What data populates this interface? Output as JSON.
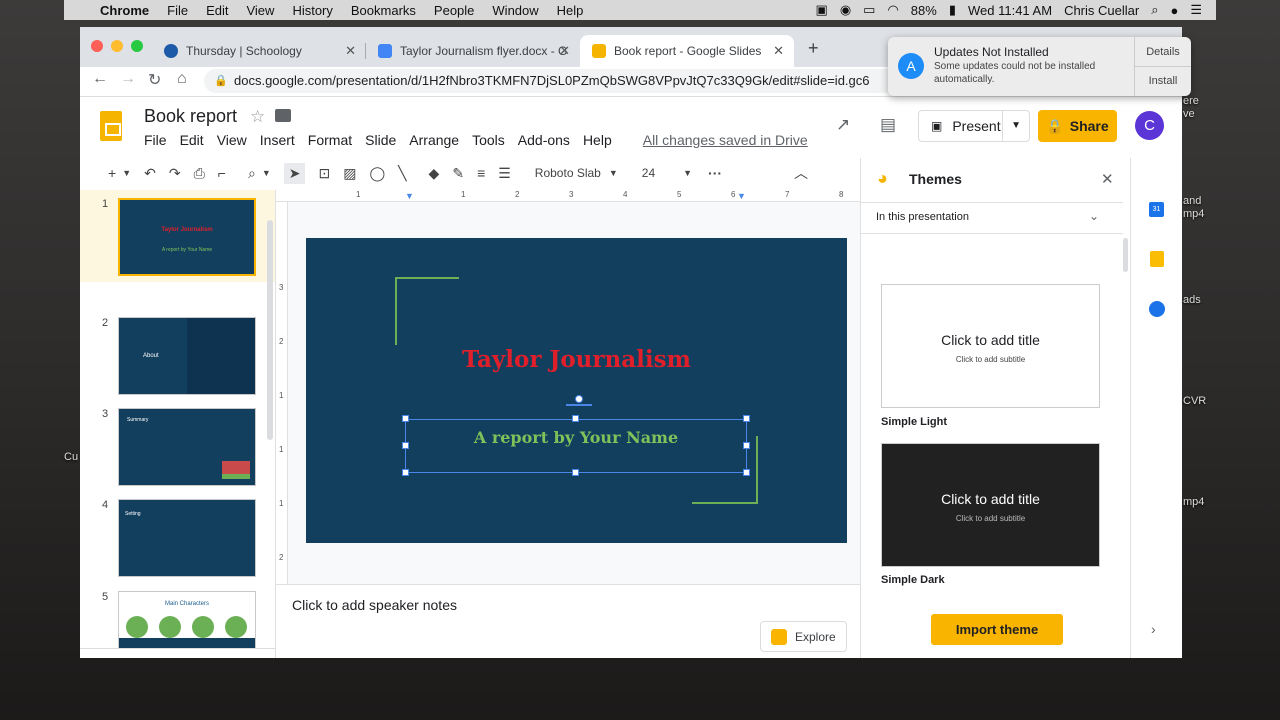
{
  "macbar": {
    "apple": "",
    "menus": [
      "Chrome",
      "File",
      "Edit",
      "View",
      "History",
      "Bookmarks",
      "People",
      "Window",
      "Help"
    ],
    "battery": "88%",
    "clock": "Wed 11:41 AM",
    "user": "Chris Cuellar"
  },
  "desktop": {
    "labels": [
      "Cu",
      "and",
      "mp4",
      "ads",
      "CVR",
      "mp4",
      "ere",
      "ve"
    ]
  },
  "browser": {
    "tabs": [
      {
        "label": "Thursday | Schoology",
        "color": "#1d5aa8"
      },
      {
        "label": "Taylor Journalism flyer.docx - G",
        "color": "#4285f4"
      },
      {
        "label": "Book report - Google Slides",
        "color": "#f4b400"
      }
    ],
    "new_tab": "+",
    "url": "docs.google.com/presentation/d/1H2fNbro3TKMFN7DjSL0PZmQbSWG8VPpvJtQ7c33Q9Gk/edit#slide=id.gc6"
  },
  "notification": {
    "title": "Updates Not Installed",
    "body": "Some updates could not be installed automatically.",
    "details": "Details",
    "install": "Install"
  },
  "docs": {
    "title": "Book report",
    "menu": [
      "File",
      "Edit",
      "View",
      "Insert",
      "Format",
      "Slide",
      "Arrange",
      "Tools",
      "Add-ons",
      "Help"
    ],
    "saved": "All changes saved in Drive",
    "present": "Present",
    "share": "Share",
    "avatar": "C"
  },
  "toolbar": {
    "font": "Roboto Slab",
    "size": "24",
    "more": "···"
  },
  "ruler": {
    "h": [
      "1",
      "1",
      "2",
      "3",
      "4",
      "5",
      "6",
      "7",
      "8"
    ],
    "v": [
      "3",
      "2",
      "1",
      "1",
      "1",
      "2"
    ]
  },
  "filmstrip": [
    {
      "num": "1",
      "t": "Taylor Journalism",
      "s": "A report by Your Name"
    },
    {
      "num": "2",
      "t": "About"
    },
    {
      "num": "3",
      "t": "Summary"
    },
    {
      "num": "4",
      "t": "Setting"
    },
    {
      "num": "5",
      "t": "Main Characters"
    }
  ],
  "slide": {
    "title": "Taylor Journalism",
    "subtitle": "A report by Your Name"
  },
  "notes": "Click to add speaker notes",
  "explore": "Explore",
  "themes": {
    "title": "Themes",
    "dropdown": "In this presentation",
    "cards": [
      {
        "name": "Simple Light",
        "ct": "Click to add title",
        "cs": "Click to add subtitle",
        "bg": "#ffffff",
        "fg": "#202124"
      },
      {
        "name": "Simple Dark",
        "ct": "Click to add title",
        "cs": "Click to add subtitle",
        "bg": "#212121",
        "fg": "#ffffff"
      }
    ],
    "import": "Import theme"
  }
}
